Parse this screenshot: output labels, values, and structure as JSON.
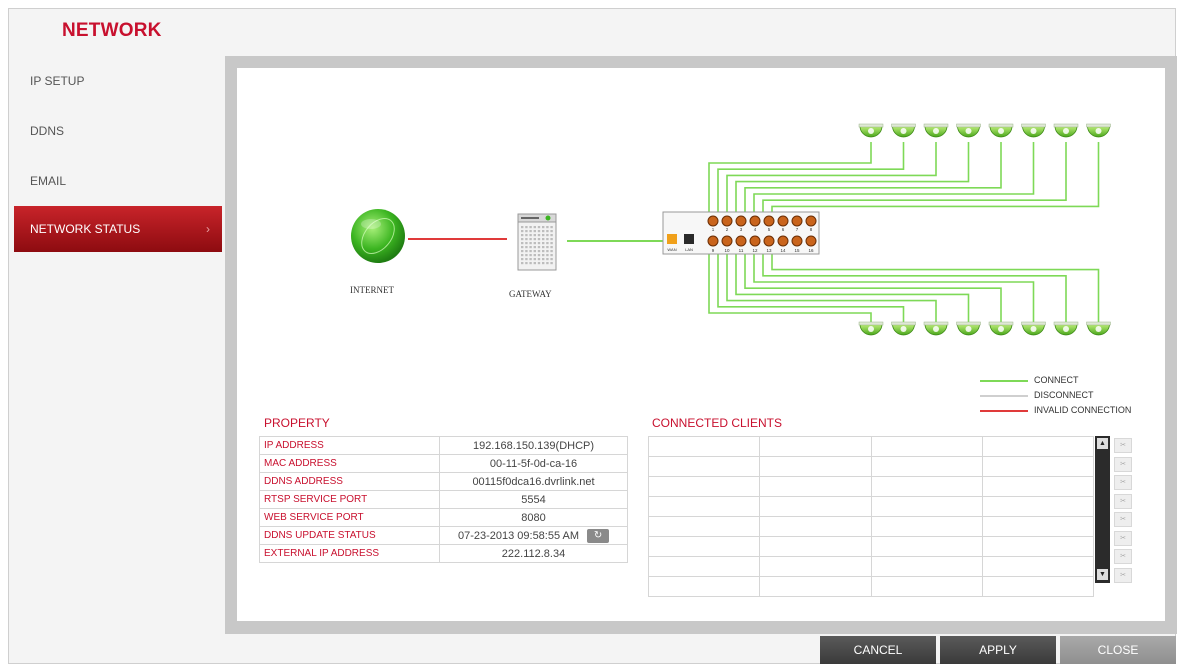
{
  "page": {
    "title": "NETWORK"
  },
  "sidebar": {
    "items": [
      {
        "label": "IP SETUP",
        "active": false
      },
      {
        "label": "DDNS",
        "active": false
      },
      {
        "label": "EMAIL",
        "active": false
      },
      {
        "label": "NETWORK STATUS",
        "active": true
      }
    ]
  },
  "diagram": {
    "internet_label": "INTERNET",
    "gateway_label": "GATEWAY",
    "wan_label": "WAN",
    "lan_label": "LAN",
    "port_numbers": [
      "1",
      "2",
      "3",
      "4",
      "5",
      "6",
      "7",
      "8",
      "9",
      "10",
      "11",
      "12",
      "13",
      "14",
      "15",
      "16"
    ],
    "camera_count": 16,
    "legend": [
      {
        "label": "CONNECT",
        "color": "#7ed957"
      },
      {
        "label": "DISCONNECT",
        "color": "#cfcfcf"
      },
      {
        "label": "INVALID CONNECTION",
        "color": "#e03a3a"
      }
    ]
  },
  "property": {
    "title": "PROPERTY",
    "rows": [
      {
        "key": "IP ADDRESS",
        "value": "192.168.150.139(DHCP)"
      },
      {
        "key": "MAC ADDRESS",
        "value": "00-11-5f-0d-ca-16"
      },
      {
        "key": "DDNS ADDRESS",
        "value": "00115f0dca16.dvrlink.net"
      },
      {
        "key": "RTSP SERVICE PORT",
        "value": "5554"
      },
      {
        "key": "WEB SERVICE PORT",
        "value": "8080"
      },
      {
        "key": "DDNS UPDATE STATUS",
        "value": "07-23-2013  09:58:55 AM"
      },
      {
        "key": "EXTERNAL IP ADDRESS",
        "value": "222.112.8.34"
      }
    ]
  },
  "clients": {
    "title": "CONNECTED CLIENTS",
    "row_count": 8,
    "col_count": 4
  },
  "buttons": {
    "cancel": "CANCEL",
    "apply": "APPLY",
    "close": "CLOSE"
  },
  "colors": {
    "accent": "#c8102e",
    "connect": "#7ed957",
    "invalid": "#e03a3a",
    "disconnect": "#cfcfcf"
  }
}
